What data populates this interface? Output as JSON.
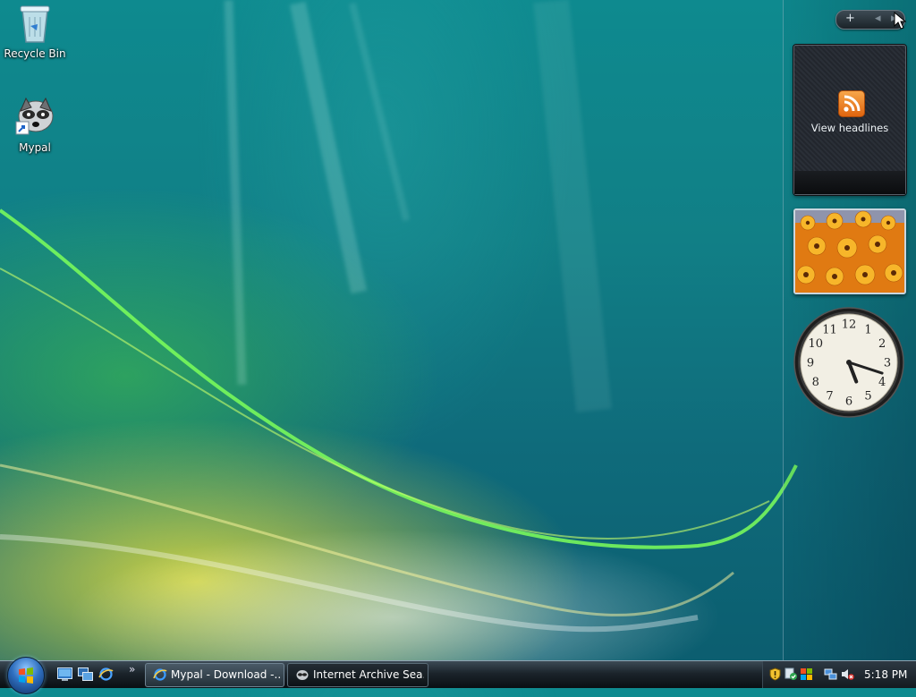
{
  "desktop": {
    "icons": [
      {
        "name": "recycle-bin",
        "label": "Recycle Bin"
      },
      {
        "name": "mypal",
        "label": "Mypal"
      }
    ]
  },
  "sidebar": {
    "controls": {
      "add": "+",
      "back": "◂",
      "forward": "▸"
    },
    "feed_gadget": {
      "label": "View headlines"
    },
    "clock_gadget": {
      "numbers": [
        "12",
        "1",
        "2",
        "3",
        "4",
        "5",
        "6",
        "7",
        "8",
        "9",
        "10",
        "11"
      ],
      "time": "5:18"
    }
  },
  "taskbar": {
    "more_quick_launch": "»",
    "buttons": [
      {
        "label": "Mypal - Download -...",
        "icon": "ie-icon"
      },
      {
        "label": "Internet Archive Sea...",
        "icon": "mypal-icon",
        "active": true
      }
    ],
    "clock": "5:18 PM"
  },
  "colors": {
    "accent": "#2f6fbf",
    "rss": "#f28a1d"
  }
}
